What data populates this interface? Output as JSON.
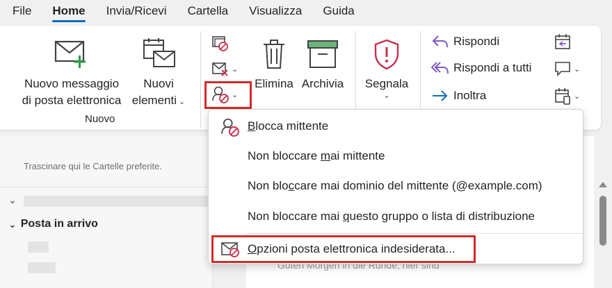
{
  "tabs": [
    {
      "label": "File",
      "active": false
    },
    {
      "label": "Home",
      "active": true
    },
    {
      "label": "Invia/Ricevi",
      "active": false
    },
    {
      "label": "Cartella",
      "active": false
    },
    {
      "label": "Visualizza",
      "active": false
    },
    {
      "label": "Guida",
      "active": false
    }
  ],
  "ribbon": {
    "new_group": {
      "new_message_line1": "Nuovo messaggio",
      "new_message_line2": "di posta elettronica",
      "new_items_line1": "Nuovi",
      "new_items_line2": "elementi",
      "group_label": "Nuovo"
    },
    "delete_label": "Elimina",
    "archive_label": "Archivia",
    "report_label": "Segnala",
    "reply_label": "Rispondi",
    "reply_all_label": "Rispondi a tutti",
    "forward_label": "Inoltra"
  },
  "junk_menu": {
    "items": [
      {
        "before": "",
        "accel": "B",
        "after": "locca mittente"
      },
      {
        "before": "Non bloccare ",
        "accel": "m",
        "after": "ai mittente"
      },
      {
        "before": "Non blo",
        "accel": "c",
        "after": "care mai dominio del mittente (@example.com)"
      },
      {
        "before": "Non bloccare mai ",
        "accel": "q",
        "after": "uesto gruppo o lista di distribuzione"
      },
      {
        "before": "",
        "accel": "O",
        "after": "pzioni posta elettronica indesiderata..."
      }
    ]
  },
  "nav": {
    "favorites_hint": "Trascinare qui le Cartelle preferite.",
    "inbox_label": "Posta in arrivo"
  },
  "list": {
    "preview_text": "Guten Morgen in die Runde, hier sind"
  },
  "colors": {
    "accent": "#0f6cbd",
    "highlight_frame": "#d42a2a",
    "report_shield": "#c4314b",
    "archive_green": "#6ab47a"
  }
}
